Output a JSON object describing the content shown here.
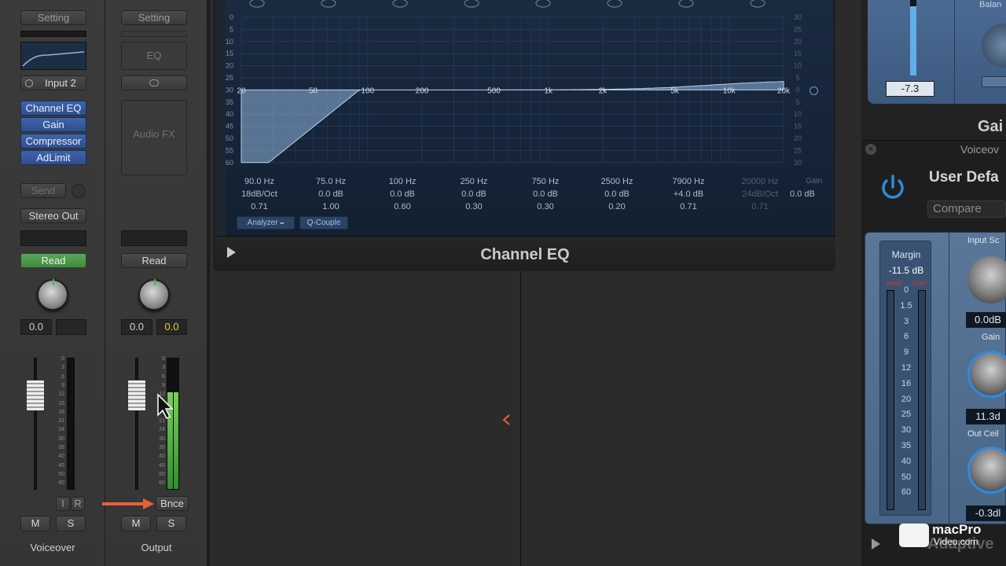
{
  "strips": [
    {
      "setting_label": "Setting",
      "input_label": "Input 2",
      "plugins": [
        "Channel EQ",
        "Gain",
        "Compressor",
        "AdLimit"
      ],
      "send_label": "Send",
      "output_label": "Stereo Out",
      "automation_label": "Read",
      "pan_value": "0.0",
      "volume_value": "",
      "ir_labels": [
        "I",
        "R"
      ],
      "mute_label": "M",
      "solo_label": "S",
      "name": "Voiceover"
    },
    {
      "setting_label": "Setting",
      "eq_label": "EQ",
      "audio_fx_label": "Audio FX",
      "automation_label": "Read",
      "pan_value": "0.0",
      "volume_value": "0.0",
      "bounce_label": "Bnce",
      "mute_label": "M",
      "solo_label": "S",
      "name": "Output"
    }
  ],
  "fader_scale": [
    "0",
    "3",
    "6",
    "9",
    "12",
    "15",
    "18",
    "21",
    "24",
    "30",
    "35",
    "40",
    "45",
    "50",
    "60"
  ],
  "channel_eq": {
    "title": "Channel EQ",
    "db_scale_left": [
      "0",
      "5",
      "10",
      "15",
      "20",
      "25",
      "30",
      "35",
      "40",
      "45",
      "50",
      "55",
      "60"
    ],
    "db_scale_right": [
      "30",
      "25",
      "20",
      "15",
      "10",
      "5",
      "0",
      "5",
      "10",
      "15",
      "20",
      "25",
      "30"
    ],
    "freq_labels": [
      "20",
      "50",
      "100",
      "200",
      "500",
      "1k",
      "2k",
      "5k",
      "10k",
      "20k"
    ],
    "bands": [
      {
        "freq": "90.0 Hz",
        "gain": "18dB/Oct",
        "q": "0.71"
      },
      {
        "freq": "75.0 Hz",
        "gain": "0.0 dB",
        "q": "1.00"
      },
      {
        "freq": "100 Hz",
        "gain": "0.0 dB",
        "q": "0.60"
      },
      {
        "freq": "250 Hz",
        "gain": "0.0 dB",
        "q": "0.30"
      },
      {
        "freq": "750 Hz",
        "gain": "0.0 dB",
        "q": "0.30"
      },
      {
        "freq": "2500 Hz",
        "gain": "0.0 dB",
        "q": "0.20"
      },
      {
        "freq": "7900 Hz",
        "gain": "+4.0 dB",
        "q": "0.71"
      },
      {
        "freq": "20000 Hz",
        "gain": "24dB/Oct",
        "q": "0.71"
      }
    ],
    "gain_label": "Gain",
    "gain_value": "0.0 dB",
    "analyzer_label": "Analyzer",
    "qcouple_label": "Q-Couple"
  },
  "right_panel": {
    "fader_value": "-7.3",
    "balance_label": "Balan",
    "gain_cut_label": "Gai",
    "preset_window_title": "Voiceov",
    "preset_name": "User Defa",
    "compare_label": "Compare",
    "margin_label": "Margin",
    "margin_value": "-11.5 dB",
    "over_labels": [
      "over",
      "over"
    ],
    "meter_scale": [
      "0",
      "1.5",
      "3",
      "6",
      "9",
      "12",
      "16",
      "20",
      "25",
      "30",
      "35",
      "40",
      "50",
      "60"
    ],
    "input_scale_label": "Input Sc",
    "input_scale_value": "0.0dB",
    "gain_knob_label": "Gain",
    "gain_knob_value": "11.3d",
    "out_ceiling_label": "Out Ceil",
    "out_ceiling_value": "-0.3dl",
    "plugin_name_partial": "Adaptive"
  },
  "watermark": {
    "brand": "macPro",
    "sub": "Video.com"
  },
  "colors": {
    "accent_blue": "#3e64a9",
    "read_green": "#4f9a4f",
    "arrow_orange": "#e8613a",
    "volume_yellow": "#e6c84a"
  }
}
